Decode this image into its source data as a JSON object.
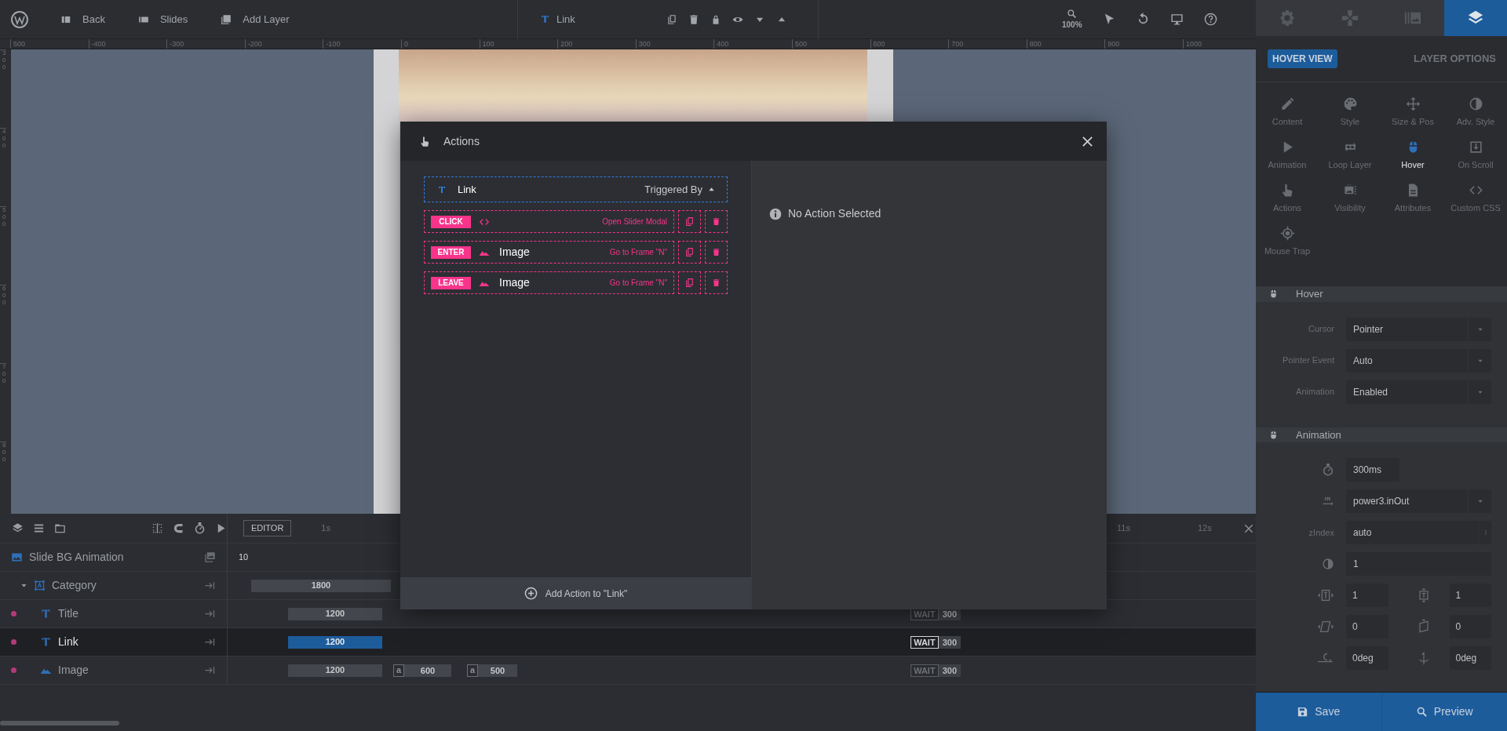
{
  "topbar": {
    "nav": [
      {
        "label": "Back"
      },
      {
        "label": "Slides"
      },
      {
        "label": "Add Layer"
      }
    ],
    "layer_name": "Link",
    "zoom": "100%"
  },
  "panel_tabs": [
    {
      "selected": false
    },
    {
      "selected": false
    },
    {
      "selected": false
    },
    {
      "selected": true
    }
  ],
  "ruler": {
    "labels": [
      "500",
      "-400",
      "-300",
      "-200",
      "-100",
      "0",
      "100",
      "200",
      "300",
      "400",
      "500",
      "600",
      "700",
      "800",
      "900",
      "1000"
    ],
    "side_labels": [
      "300",
      "400",
      "500",
      "600",
      "700",
      "800"
    ]
  },
  "modal": {
    "title": "Actions",
    "layer": "Link",
    "triggered_by": "Triggered By",
    "actions": [
      {
        "event": "CLICK",
        "kind": "code",
        "action": "Open Slider Modal"
      },
      {
        "event": "ENTER",
        "kind": "image",
        "target": "Image",
        "action": "Go to Frame \"N\""
      },
      {
        "event": "LEAVE",
        "kind": "image",
        "target": "Image",
        "action": "Go to Frame \"N\""
      }
    ],
    "add_button": "Add Action to \"Link\"",
    "message": "No Action Selected"
  },
  "timeline": {
    "mode": "EDITOR",
    "time_labels": [
      "1s",
      "11s",
      "12s"
    ],
    "layers": [
      {
        "name": "Slide BG Animation",
        "kind": "background",
        "selected": false,
        "bars": [
          {
            "kind": "value",
            "label": "10"
          }
        ]
      },
      {
        "name": "Category",
        "kind": "group",
        "selected": false,
        "expanded": true,
        "bars": [
          {
            "kind": "bar",
            "label": "1800"
          }
        ],
        "children": [
          {
            "name": "Title",
            "kind": "text",
            "selected": false,
            "bars": [
              {
                "kind": "bar",
                "label": "1200"
              },
              {
                "kind": "wait",
                "label": "WAIT",
                "value": "300"
              }
            ]
          },
          {
            "name": "Link",
            "kind": "text",
            "selected": true,
            "bars": [
              {
                "kind": "bar",
                "label": "1200"
              },
              {
                "kind": "wait",
                "label": "WAIT",
                "value": "300"
              }
            ]
          },
          {
            "name": "Image",
            "kind": "image",
            "selected": false,
            "bars": [
              {
                "kind": "bar",
                "label": "1200"
              },
              {
                "kind": "loop",
                "label": "a",
                "value": "600"
              },
              {
                "kind": "loop",
                "label": "a",
                "value": "500"
              },
              {
                "kind": "wait",
                "label": "WAIT",
                "value": "300"
              }
            ]
          }
        ]
      }
    ]
  },
  "panel": {
    "badge": "HOVER VIEW",
    "heading": "LAYER OPTIONS",
    "options": [
      {
        "label": "Content",
        "selected": false
      },
      {
        "label": "Style",
        "selected": false
      },
      {
        "label": "Size & Pos",
        "selected": false
      },
      {
        "label": "Adv. Style",
        "selected": false
      },
      {
        "label": "Animation",
        "selected": false
      },
      {
        "label": "Loop Layer",
        "selected": false
      },
      {
        "label": "Hover",
        "selected": true
      },
      {
        "label": "On Scroll",
        "selected": false
      },
      {
        "label": "Actions",
        "selected": false
      },
      {
        "label": "Visibility",
        "selected": false
      },
      {
        "label": "Attributes",
        "selected": false
      },
      {
        "label": "Custom CSS",
        "selected": false
      },
      {
        "label": "Mouse Trap",
        "selected": false
      }
    ],
    "sections": [
      {
        "title": "Hover",
        "fields": [
          {
            "kind": "select",
            "label": "Cursor",
            "value": "Pointer"
          },
          {
            "kind": "select",
            "label": "Pointer Event",
            "value": "Auto"
          },
          {
            "kind": "select",
            "label": "Animation",
            "value": "Enabled"
          }
        ]
      },
      {
        "title": "Animation",
        "fields": [
          {
            "kind": "short",
            "value": "300ms"
          },
          {
            "kind": "select",
            "value": "power3.inOut"
          },
          {
            "kind": "menu",
            "label": "zIndex",
            "value": "auto"
          },
          {
            "kind": "wide",
            "value": "1"
          },
          {
            "kind": "pair",
            "values": [
              "1",
              "1"
            ]
          },
          {
            "kind": "pair",
            "values": [
              "0",
              "0"
            ]
          },
          {
            "kind": "pair",
            "values": [
              "0deg",
              "0deg"
            ]
          }
        ]
      }
    ],
    "buttons": [
      {
        "label": "Save"
      },
      {
        "label": "Preview"
      }
    ]
  }
}
